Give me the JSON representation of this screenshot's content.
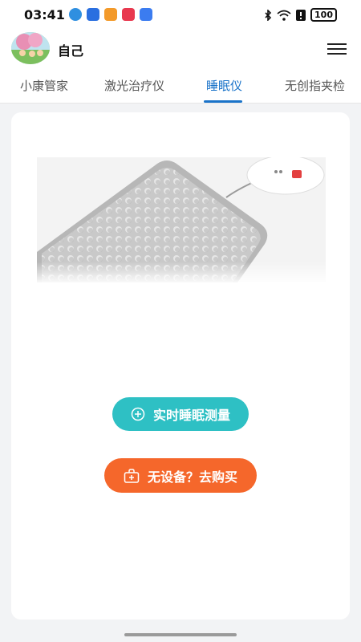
{
  "status_bar": {
    "time": "03:41",
    "battery": "100",
    "icons": [
      "bluetooth-icon",
      "wifi-icon",
      "alert-icon",
      "battery-icon"
    ]
  },
  "header": {
    "user_name": "自己",
    "menu_icon": "hamburger-menu-icon"
  },
  "tabs": [
    {
      "label": "小康管家",
      "active": false
    },
    {
      "label": "激光治疗仪",
      "active": false
    },
    {
      "label": "睡眠仪",
      "active": true
    },
    {
      "label": "无创指夹检",
      "active": false
    }
  ],
  "main": {
    "measure_button": "实时睡眠测量",
    "buy_button": "无设备？去购买"
  },
  "colors": {
    "accent_blue": "#1a73c9",
    "teal_button": "#2ec0c4",
    "orange_button": "#f5672b"
  }
}
